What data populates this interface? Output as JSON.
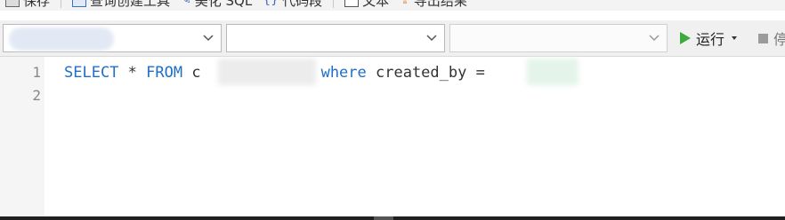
{
  "toolbar": {
    "save_label": "保存",
    "query_builder_label": "查询创建工具",
    "beautify_label": "美化 SQL",
    "snippet_label": "代码段",
    "text_label": "文本",
    "export_label": "导出结果"
  },
  "selectors": {
    "connection": {
      "value": ""
    },
    "database": {
      "value": ""
    },
    "schema": {
      "value": ""
    }
  },
  "actions": {
    "run_label": "运行",
    "stop_label": "停"
  },
  "editor": {
    "line_numbers": [
      "1",
      "2"
    ],
    "line1": {
      "select_kw": "SELECT",
      "star": " * ",
      "from_kw": "FROM",
      "table_prefix": " c",
      "where_kw": "where",
      "rest": " created_by = "
    }
  },
  "colors": {
    "keyword": "#1f6fc6",
    "run_icon": "#3caa3c",
    "gutter_bg": "#f5f5f5",
    "toolbar_bg": "#f0f0f0"
  },
  "icons": {
    "save": "save-icon",
    "query_builder": "query-builder-icon",
    "beautify": "beautify-sql-icon",
    "snippet": "code-snippet-icon",
    "text": "text-icon",
    "export": "export-results-icon",
    "run": "play-icon",
    "stop": "stop-icon",
    "dropdown": "chevron-down-icon"
  }
}
